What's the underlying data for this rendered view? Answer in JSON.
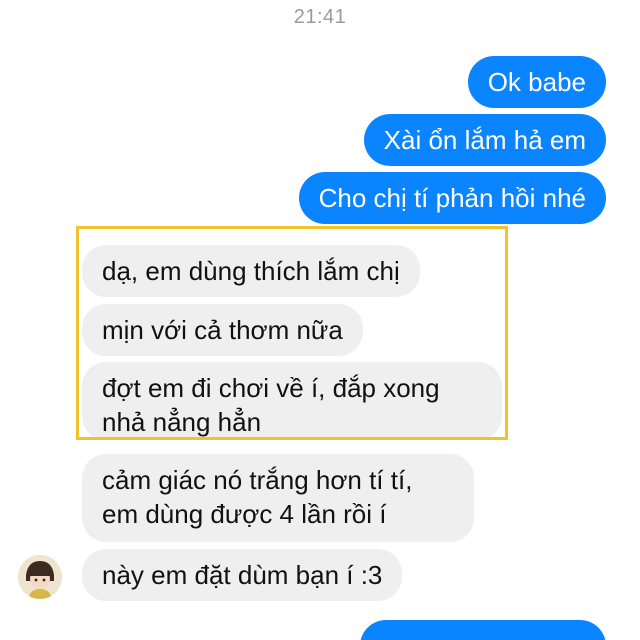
{
  "chat": {
    "timestamp": "21:41",
    "outgoing": [
      {
        "text": "Ok babe"
      },
      {
        "text": "Xài ổn lắm hả em"
      },
      {
        "text": "Cho chị tí phản hồi nhé"
      }
    ],
    "incoming_highlighted": [
      {
        "text": "dạ, em dùng thích lắm chị"
      },
      {
        "text": "mịn với cả thơm nữa"
      },
      {
        "text": "đợt em đi chơi về í, đắp xong nhả nẳng hẳn"
      }
    ],
    "incoming_more": [
      {
        "text": "cảm giác nó trắng hơn tí tí, em dùng được 4 lần rồi í"
      },
      {
        "text": "này em đặt dùm bạn í :3"
      }
    ]
  },
  "colors": {
    "outgoing_bubble": "#0a84ff",
    "incoming_bubble": "#efefef",
    "highlight_border": "#f2c12e"
  },
  "icons": {
    "avatar": "contact-avatar"
  }
}
